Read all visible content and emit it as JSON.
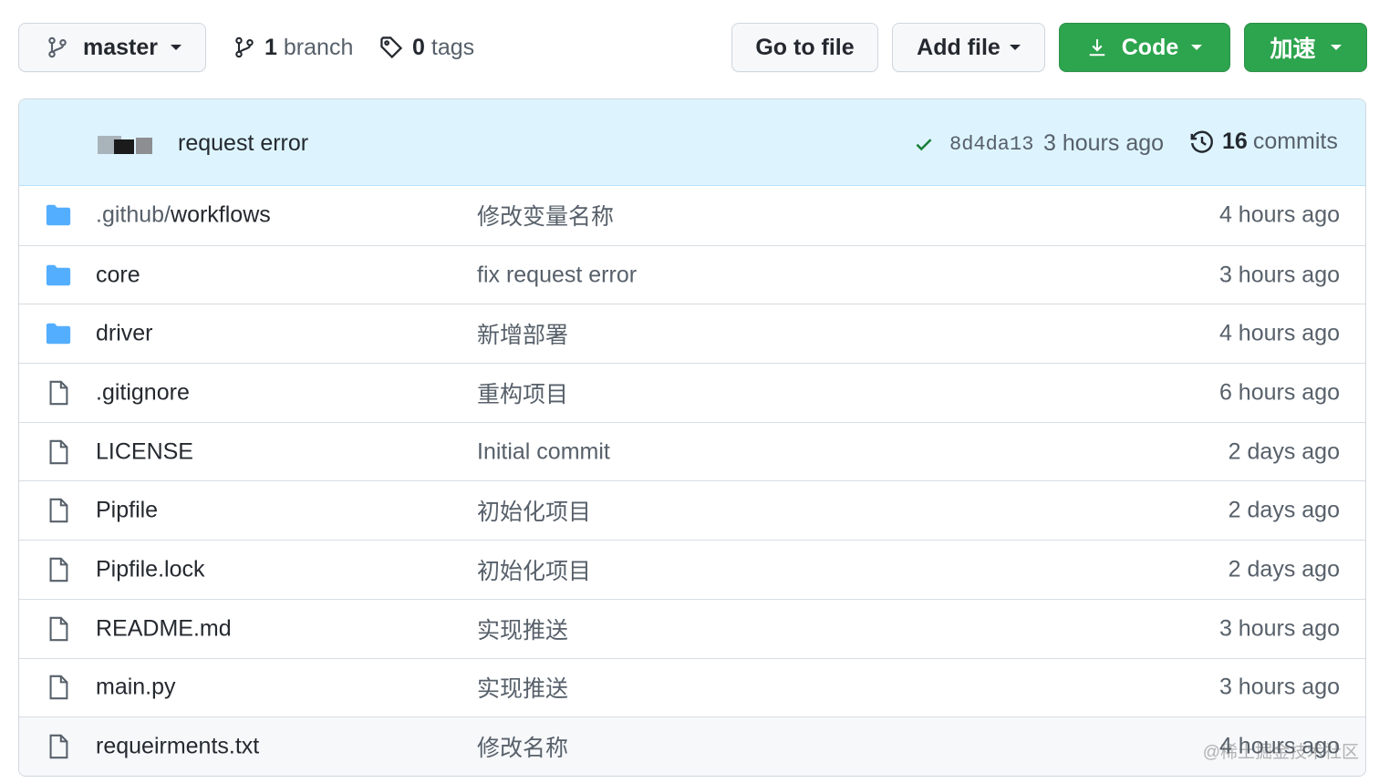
{
  "toolbar": {
    "branch_select": {
      "label": "master"
    },
    "branches": {
      "count": "1",
      "label": "branch"
    },
    "tags": {
      "count": "0",
      "label": "tags"
    },
    "go_to_file": "Go to file",
    "add_file": "Add file",
    "code": "Code",
    "accelerate": "加速"
  },
  "latest_commit": {
    "message": "request error",
    "sha": "8d4da13",
    "time": "3 hours ago",
    "commits_count": "16",
    "commits_label": "commits"
  },
  "files": [
    {
      "type": "folder",
      "name_prefix": ".github/",
      "name": "workflows",
      "message": "修改变量名称",
      "age": "4 hours ago"
    },
    {
      "type": "folder",
      "name_prefix": "",
      "name": "core",
      "message": "fix request error",
      "age": "3 hours ago"
    },
    {
      "type": "folder",
      "name_prefix": "",
      "name": "driver",
      "message": "新增部署",
      "age": "4 hours ago"
    },
    {
      "type": "file",
      "name_prefix": "",
      "name": ".gitignore",
      "message": "重构项目",
      "age": "6 hours ago"
    },
    {
      "type": "file",
      "name_prefix": "",
      "name": "LICENSE",
      "message": "Initial commit",
      "age": "2 days ago"
    },
    {
      "type": "file",
      "name_prefix": "",
      "name": "Pipfile",
      "message": "初始化项目",
      "age": "2 days ago"
    },
    {
      "type": "file",
      "name_prefix": "",
      "name": "Pipfile.lock",
      "message": "初始化项目",
      "age": "2 days ago"
    },
    {
      "type": "file",
      "name_prefix": "",
      "name": "README.md",
      "message": "实现推送",
      "age": "3 hours ago"
    },
    {
      "type": "file",
      "name_prefix": "",
      "name": "main.py",
      "message": "实现推送",
      "age": "3 hours ago"
    },
    {
      "type": "file",
      "name_prefix": "",
      "name": "requeirments.txt",
      "message": "修改名称",
      "age": "4 hours ago"
    }
  ],
  "watermark": "@稀土掘金技术社区",
  "colors": {
    "folder": "#54aeff",
    "file_icon": "#57606a",
    "green_button": "#2da44e",
    "header_bg": "#ddf4ff",
    "check": "#1a7f37"
  },
  "icons": {
    "branch": "git-branch-icon",
    "tag": "tag-icon",
    "download": "download-icon",
    "check": "check-icon",
    "history": "history-icon",
    "folder": "folder-icon",
    "file": "file-icon"
  }
}
